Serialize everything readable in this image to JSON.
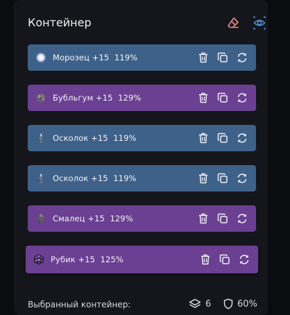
{
  "title": "Контейнер",
  "items": [
    {
      "name": "Морозец",
      "bonus": "+15",
      "pct": "119%",
      "color": "blue",
      "icon": "frost-orb-icon"
    },
    {
      "name": "Бубльгум",
      "bonus": "+15",
      "pct": "129%",
      "color": "purple",
      "icon": "bubblegum-gem-icon"
    },
    {
      "name": "Осколок",
      "bonus": "+15",
      "pct": "119%",
      "color": "blue",
      "icon": "shard-figure-icon"
    },
    {
      "name": "Осколок",
      "bonus": "+15",
      "pct": "119%",
      "color": "blue",
      "icon": "shard-figure-icon"
    },
    {
      "name": "Смалец",
      "bonus": "+15",
      "pct": "129%",
      "color": "purple",
      "icon": "lard-stone-icon"
    },
    {
      "name": "Рубик",
      "bonus": "+15",
      "pct": "125%",
      "color": "purple",
      "icon": "rubik-cube-icon"
    }
  ],
  "footer": {
    "label": "Выбранный контейнер:",
    "layers": "6",
    "defense": "60%"
  },
  "colors": {
    "blue": "#3e6189",
    "purple": "#6b3f92",
    "eraser": "#e38b8b",
    "eye": "#4f95d9"
  }
}
